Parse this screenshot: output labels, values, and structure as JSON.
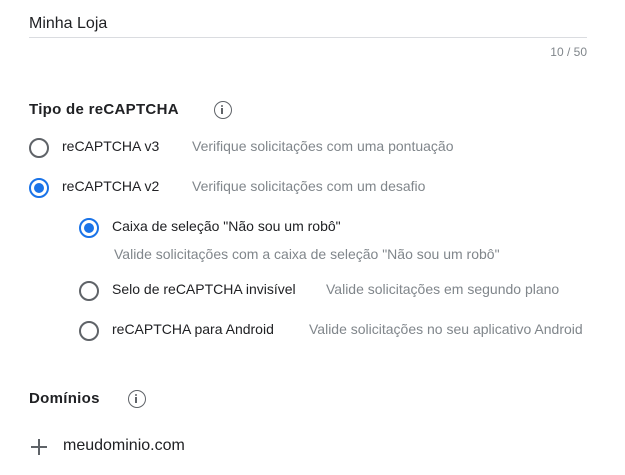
{
  "label": {
    "value": "Minha Loja",
    "counter": "10 / 50"
  },
  "recaptcha_type": {
    "title": "Tipo de reCAPTCHA",
    "info_icon": "info-icon",
    "options": [
      {
        "label": "reCAPTCHA v3",
        "description": "Verifique solicitações com uma pontuação",
        "selected": false
      },
      {
        "label": "reCAPTCHA v2",
        "description": "Verifique solicitações com um desafio",
        "selected": true
      }
    ],
    "v2_options": [
      {
        "label": "Caixa de seleção \"Não sou um robô\"",
        "description": "Valide solicitações com a caixa de seleção \"Não sou um robô\"",
        "selected": true
      },
      {
        "label": "Selo de reCAPTCHA invisível",
        "description": "Valide solicitações em segundo plano",
        "selected": false
      },
      {
        "label": "reCAPTCHA para Android",
        "description": "Valide solicitações no seu aplicativo Android",
        "selected": false
      }
    ]
  },
  "domains": {
    "title": "Domínios",
    "info_icon": "info-icon",
    "add_icon": "plus-icon",
    "entry": "meudominio.com"
  },
  "colors": {
    "accent": "#1a73e8",
    "text": "#202124",
    "secondary_text": "#80868b",
    "icon": "#5f6368",
    "divider": "#dadce0"
  }
}
